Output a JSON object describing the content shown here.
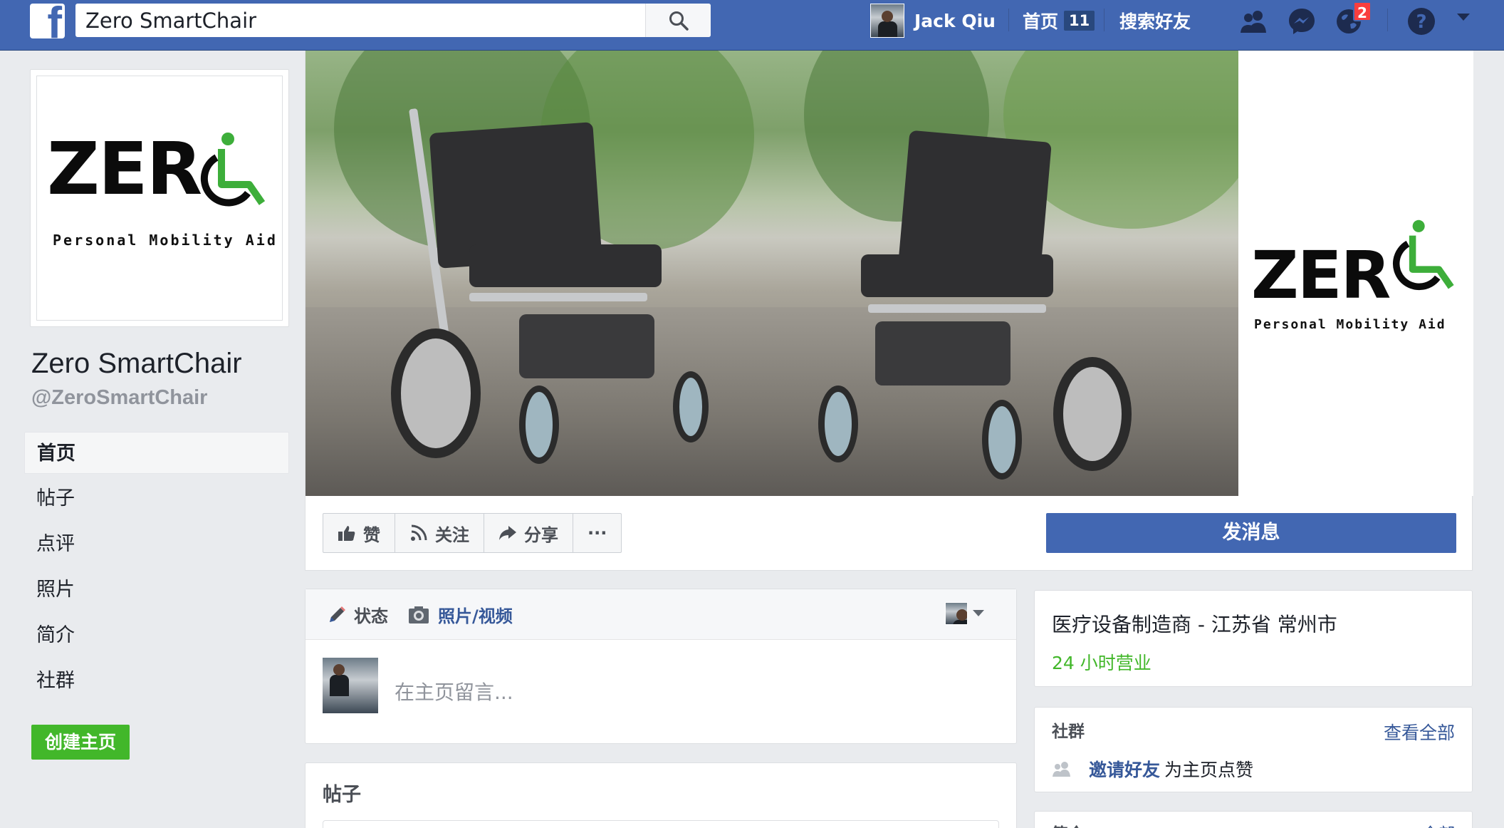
{
  "topbar": {
    "search_value": "Zero SmartChair",
    "user_name": "Jack Qiu",
    "home_label": "首页",
    "home_count": "11",
    "find_friends": "搜索好友",
    "notifications_count": "2"
  },
  "page": {
    "name": "Zero SmartChair",
    "handle": "@ZeroSmartChair",
    "logo_word": "ZER",
    "logo_tagline": "Personal Mobility Aid"
  },
  "sidebar": {
    "items": [
      {
        "label": "首页"
      },
      {
        "label": "帖子"
      },
      {
        "label": "点评"
      },
      {
        "label": "照片"
      },
      {
        "label": "简介"
      },
      {
        "label": "社群"
      }
    ],
    "create_page": "创建主页"
  },
  "actions": {
    "like": "赞",
    "follow": "关注",
    "share": "分享",
    "more": "···",
    "message": "发消息"
  },
  "composer": {
    "tab_status": "状态",
    "tab_photo": "照片/视频",
    "placeholder": "在主页留言..."
  },
  "posts": {
    "title": "帖子"
  },
  "info": {
    "category": "医疗设备制造商 - 江苏省 常州市",
    "hours": "24 小时营业"
  },
  "community": {
    "title": "社群",
    "see_all": "查看全部",
    "invite_link": "邀请好友",
    "invite_text": "为主页点赞"
  },
  "about": {
    "title": "简介",
    "see_all": "全部"
  },
  "colors": {
    "brand_blue": "#4267b2",
    "green": "#42b72a",
    "logo_green": "#3dae3a"
  }
}
